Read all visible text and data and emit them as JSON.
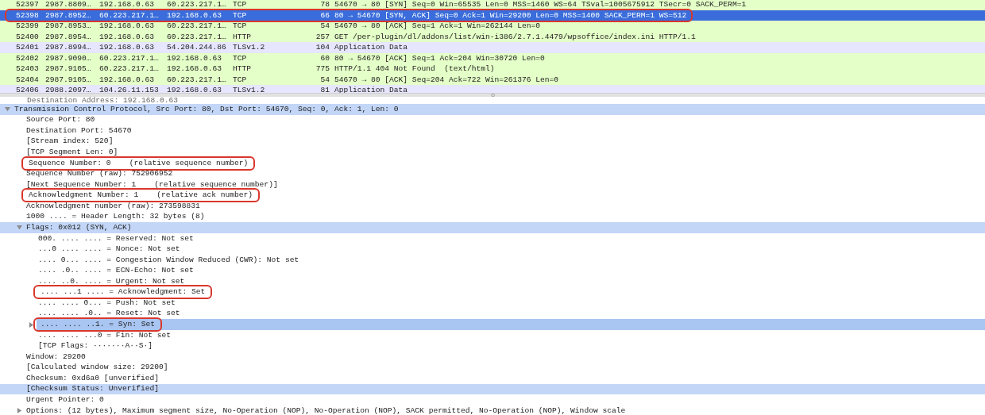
{
  "packet_list": {
    "rows": [
      {
        "no": "52397",
        "time": "2987.8809…",
        "source": "192.168.0.63",
        "destination": "60.223.217.1…",
        "protocol": "TCP",
        "length": "78",
        "info": "54670 → 80 [SYN] Seq=0 Win=65535 Len=0 MSS=1460 WS=64 TSval=1005675912 TSecr=0 SACK_PERM=1",
        "color": "#e4ffc7",
        "selected": false,
        "annotated": false
      },
      {
        "no": "52398",
        "time": "2987.8952…",
        "source": "60.223.217.1…",
        "destination": "192.168.0.63",
        "protocol": "TCP",
        "length": "66",
        "info": "80 → 54670 [SYN, ACK] Seq=0 Ack=1 Win=29200 Len=0 MSS=1400 SACK_PERM=1 WS=512",
        "selected": true,
        "annotated": true
      },
      {
        "no": "52399",
        "time": "2987.8953…",
        "source": "192.168.0.63",
        "destination": "60.223.217.1…",
        "protocol": "TCP",
        "length": "54",
        "info": "54670 → 80 [ACK] Seq=1 Ack=1 Win=262144 Len=0",
        "color": "#e4ffc7",
        "selected": false,
        "annotated": false
      },
      {
        "no": "52400",
        "time": "2987.8954…",
        "source": "192.168.0.63",
        "destination": "60.223.217.1…",
        "protocol": "HTTP",
        "length": "257",
        "info": "GET /per-plugin/dl/addons/list/win-i386/2.7.1.4479/wpsoffice/index.ini HTTP/1.1",
        "color": "#e4ffc7",
        "selected": false,
        "annotated": false
      },
      {
        "no": "52401",
        "time": "2987.8994…",
        "source": "192.168.0.63",
        "destination": "54.204.244.86",
        "protocol": "TLSv1.2",
        "length": "104",
        "info": "Application Data",
        "color": "#e7e6ff",
        "selected": false,
        "annotated": false
      },
      {
        "no": "52402",
        "time": "2987.9090…",
        "source": "60.223.217.1…",
        "destination": "192.168.0.63",
        "protocol": "TCP",
        "length": "60",
        "info": "80 → 54670 [ACK] Seq=1 Ack=204 Win=30720 Len=0",
        "color": "#e4ffc7",
        "selected": false,
        "annotated": false
      },
      {
        "no": "52403",
        "time": "2987.9105…",
        "source": "60.223.217.1…",
        "destination": "192.168.0.63",
        "protocol": "HTTP",
        "length": "775",
        "info": "HTTP/1.1 404 Not Found  (text/html)",
        "color": "#e4ffc7",
        "selected": false,
        "annotated": false
      },
      {
        "no": "52404",
        "time": "2987.9105…",
        "source": "192.168.0.63",
        "destination": "60.223.217.1…",
        "protocol": "TCP",
        "length": "54",
        "info": "54670 → 80 [ACK] Seq=204 Ack=722 Win=261376 Len=0",
        "color": "#e4ffc7",
        "selected": false,
        "annotated": false
      },
      {
        "no": "52406",
        "time": "2988.2097…",
        "source": "104.26.11.153",
        "destination": "192.168.0.63",
        "protocol": "TLSv1.2",
        "length": "81",
        "info": "Application Data",
        "color": "#e7e6ff",
        "selected": false,
        "annotated": false
      }
    ]
  },
  "details": {
    "cut_line": "Destination Address: 192.168.0.63",
    "tree": [
      {
        "text": "Transmission Control Protocol, Src Port: 80, Dst Port: 54670, Seq: 0, Ack: 1, Len: 0",
        "expanded": true,
        "highlighted": true,
        "selected": false,
        "annotated": false,
        "children": [
          {
            "text": "Source Port: 80",
            "highlighted": false,
            "selected": false,
            "annotated": false
          },
          {
            "text": "Destination Port: 54670",
            "highlighted": false,
            "selected": false,
            "annotated": false
          },
          {
            "text": "[Stream index: 520]",
            "highlighted": false,
            "selected": false,
            "annotated": false
          },
          {
            "text": "[TCP Segment Len: 0]",
            "highlighted": false,
            "selected": false,
            "annotated": false
          },
          {
            "text": "Sequence Number: 0    (relative sequence number)",
            "highlighted": false,
            "selected": false,
            "annotated": true
          },
          {
            "text": "Sequence Number (raw): 752906952",
            "highlighted": false,
            "selected": false,
            "annotated": false
          },
          {
            "text": "[Next Sequence Number: 1    (relative sequence number)]",
            "highlighted": false,
            "selected": false,
            "annotated": false
          },
          {
            "text": "Acknowledgment Number: 1    (relative ack number)",
            "highlighted": false,
            "selected": false,
            "annotated": true
          },
          {
            "text": "Acknowledgment number (raw): 273598831",
            "highlighted": false,
            "selected": false,
            "annotated": false
          },
          {
            "text": "1000 .... = Header Length: 32 bytes (8)",
            "highlighted": false,
            "selected": false,
            "annotated": false
          },
          {
            "text": "Flags: 0x012 (SYN, ACK)",
            "expanded": true,
            "highlighted": true,
            "selected": false,
            "annotated": false,
            "children": [
              {
                "text": "000. .... .... = Reserved: Not set",
                "highlighted": false,
                "selected": false,
                "annotated": false
              },
              {
                "text": "...0 .... .... = Nonce: Not set",
                "highlighted": false,
                "selected": false,
                "annotated": false
              },
              {
                "text": ".... 0... .... = Congestion Window Reduced (CWR): Not set",
                "highlighted": false,
                "selected": false,
                "annotated": false
              },
              {
                "text": ".... .0.. .... = ECN-Echo: Not set",
                "highlighted": false,
                "selected": false,
                "annotated": false
              },
              {
                "text": ".... ..0. .... = Urgent: Not set",
                "highlighted": false,
                "selected": false,
                "annotated": false
              },
              {
                "text": ".... ...1 .... = Acknowledgment: Set",
                "highlighted": false,
                "selected": false,
                "annotated": true
              },
              {
                "text": ".... .... 0... = Push: Not set",
                "highlighted": false,
                "selected": false,
                "annotated": false
              },
              {
                "text": ".... .... .0.. = Reset: Not set",
                "highlighted": false,
                "selected": false,
                "annotated": false
              },
              {
                "text": ".... .... ..1. = Syn: Set",
                "expanded": false,
                "highlighted": false,
                "selected": true,
                "annotated": true
              },
              {
                "text": ".... .... ...0 = Fin: Not set",
                "highlighted": false,
                "selected": false,
                "annotated": false
              },
              {
                "text": "[TCP Flags: ·······A··S·]",
                "highlighted": false,
                "selected": false,
                "annotated": false
              }
            ]
          },
          {
            "text": "Window: 29200",
            "highlighted": false,
            "selected": false,
            "annotated": false
          },
          {
            "text": "[Calculated window size: 29200]",
            "highlighted": false,
            "selected": false,
            "annotated": false
          },
          {
            "text": "Checksum: 0xd6a0 [unverified]",
            "highlighted": false,
            "selected": false,
            "annotated": false
          },
          {
            "text": "[Checksum Status: Unverified]",
            "highlighted": true,
            "selected": false,
            "annotated": false
          },
          {
            "text": "Urgent Pointer: 0",
            "highlighted": false,
            "selected": false,
            "annotated": false
          },
          {
            "text": "Options: (12 bytes), Maximum segment size, No-Operation (NOP), No-Operation (NOP), SACK permitted, No-Operation (NOP), Window scale",
            "expanded": false,
            "highlighted": false,
            "selected": false,
            "annotated": false
          }
        ]
      }
    ]
  }
}
